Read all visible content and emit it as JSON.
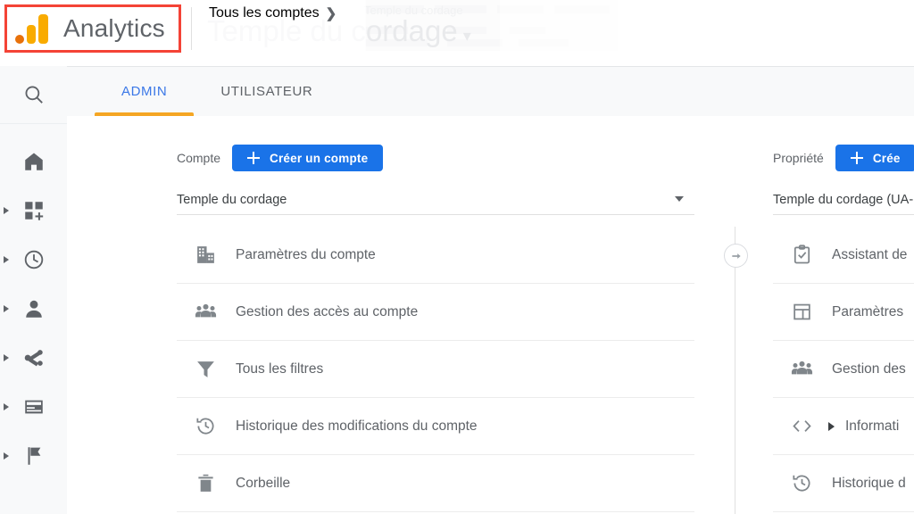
{
  "header": {
    "logo_text": "Analytics",
    "logo_icon": "analytics-logo-icon",
    "highlight_color": "#f44336",
    "breadcrumb": {
      "account_link": "Tous les comptes",
      "chevron": "❯"
    },
    "ghost_title": "Temple du cordage",
    "ghost_caret": "▾",
    "ghost_subtitle": "Temple du cordage"
  },
  "sidebar": {
    "search": {
      "name": "search-icon"
    },
    "items": [
      {
        "name": "home",
        "icon": "home-icon",
        "expandable": false
      },
      {
        "name": "customization",
        "icon": "customization-grid-icon",
        "expandable": true
      },
      {
        "name": "realtime",
        "icon": "clock-icon",
        "expandable": true
      },
      {
        "name": "audience",
        "icon": "person-icon",
        "expandable": true
      },
      {
        "name": "acquisition",
        "icon": "share-nodes-icon",
        "expandable": true
      },
      {
        "name": "behavior",
        "icon": "window-card-icon",
        "expandable": true
      },
      {
        "name": "conversions",
        "icon": "flag-icon",
        "expandable": true
      }
    ]
  },
  "tabs": [
    {
      "label": "ADMIN",
      "active": true,
      "accent": "#f5a623",
      "text_color": "#3b78e7"
    },
    {
      "label": "UTILISATEUR",
      "active": false
    }
  ],
  "columns": {
    "account": {
      "label": "Compte",
      "create_button": "Créer un compte",
      "selected": "Temple du cordage",
      "items": [
        {
          "label": "Paramètres du compte",
          "icon": "building-icon"
        },
        {
          "label": "Gestion des accès au compte",
          "icon": "people-icon"
        },
        {
          "label": "Tous les filtres",
          "icon": "funnel-icon"
        },
        {
          "label": "Historique des modifications du compte",
          "icon": "history-icon"
        },
        {
          "label": "Corbeille",
          "icon": "trash-icon"
        }
      ]
    },
    "property": {
      "label": "Propriété",
      "create_button": "Crée",
      "selected": "Temple du cordage (UA-",
      "items": [
        {
          "label": "Assistant de",
          "icon": "checklist-clipboard-icon",
          "expandable": false
        },
        {
          "label": "Paramètres",
          "icon": "property-window-icon",
          "expandable": false
        },
        {
          "label": "Gestion des",
          "icon": "people-icon",
          "expandable": false
        },
        {
          "label": "Informati",
          "icon": "code-brackets-icon",
          "expandable": true
        },
        {
          "label": "Historique d",
          "icon": "history-icon",
          "expandable": false
        }
      ]
    }
  },
  "collapse_button": {
    "name": "collapse-columns-arrow"
  }
}
